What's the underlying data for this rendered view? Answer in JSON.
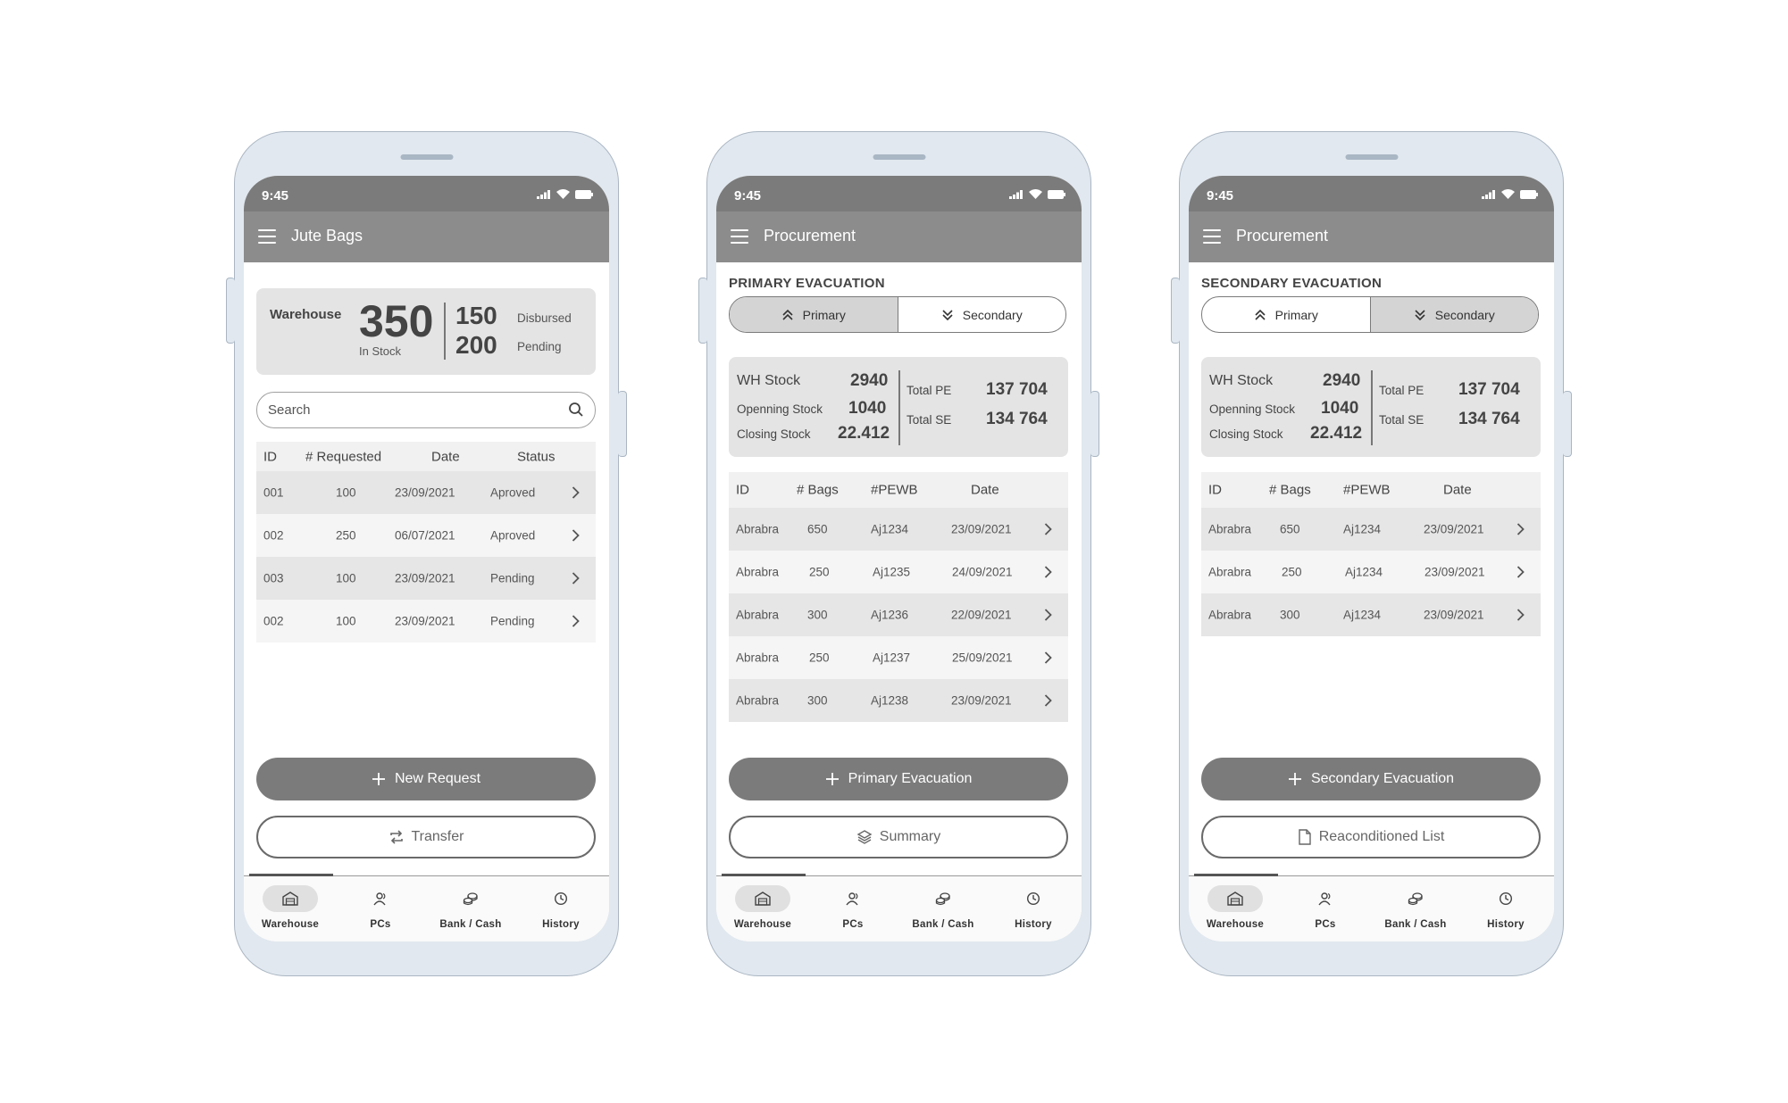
{
  "status_time": "9:45",
  "nav": [
    {
      "label": "Warehouse",
      "icon": "warehouse-icon"
    },
    {
      "label": "PCs",
      "icon": "users-icon"
    },
    {
      "label": "Bank / Cash",
      "icon": "coins-icon"
    },
    {
      "label": "History",
      "icon": "clock-icon"
    }
  ],
  "phone1": {
    "title": "Jute Bags",
    "summary": {
      "label": "Warehouse",
      "in_stock_value": "350",
      "in_stock_label": "In Stock",
      "disbursed_value": "150",
      "disbursed_label": "Disbursed",
      "pending_value": "200",
      "pending_label": "Pending"
    },
    "search_placeholder": "Search",
    "columns": [
      "ID",
      "# Requested",
      "Date",
      "Status"
    ],
    "rows": [
      [
        "001",
        "100",
        "23/09/2021",
        "Aproved"
      ],
      [
        "002",
        "250",
        "06/07/2021",
        "Aproved"
      ],
      [
        "003",
        "100",
        "23/09/2021",
        "Pending"
      ],
      [
        "002",
        "100",
        "23/09/2021",
        "Pending"
      ]
    ],
    "primary_button": "New Request",
    "secondary_button": "Transfer"
  },
  "phone2": {
    "title": "Procurement",
    "section": "PRIMARY EVACUATION",
    "tabs": [
      "Primary",
      "Secondary"
    ],
    "stats": {
      "wh_stock_label": "WH Stock",
      "wh_stock_value": "2940",
      "opening_label": "Openning Stock",
      "opening_value": "1040",
      "closing_label": "Closing Stock",
      "closing_value": "22.412",
      "total_pe_label": "Total PE",
      "total_pe_value": "137 704",
      "total_se_label": "Total SE",
      "total_se_value": "134 764"
    },
    "columns": [
      "ID",
      "# Bags",
      "#PEWB",
      "Date"
    ],
    "rows": [
      [
        "Abrabra",
        "650",
        "Aj1234",
        "23/09/2021"
      ],
      [
        "Abrabra",
        "250",
        "Aj1235",
        "24/09/2021"
      ],
      [
        "Abrabra",
        "300",
        "Aj1236",
        "22/09/2021"
      ],
      [
        "Abrabra",
        "250",
        "Aj1237",
        "25/09/2021"
      ],
      [
        "Abrabra",
        "300",
        "Aj1238",
        "23/09/2021"
      ]
    ],
    "primary_button": "Primary Evacuation",
    "secondary_button": "Summary"
  },
  "phone3": {
    "title": "Procurement",
    "section": "SECONDARY EVACUATION",
    "tabs": [
      "Primary",
      "Secondary"
    ],
    "stats": {
      "wh_stock_label": "WH Stock",
      "wh_stock_value": "2940",
      "opening_label": "Openning Stock",
      "opening_value": "1040",
      "closing_label": "Closing Stock",
      "closing_value": "22.412",
      "total_pe_label": "Total PE",
      "total_pe_value": "137 704",
      "total_se_label": "Total SE",
      "total_se_value": "134 764"
    },
    "columns": [
      "ID",
      "# Bags",
      "#PEWB",
      "Date"
    ],
    "rows": [
      [
        "Abrabra",
        "650",
        "Aj1234",
        "23/09/2021"
      ],
      [
        "Abrabra",
        "250",
        "Aj1234",
        "23/09/2021"
      ],
      [
        "Abrabra",
        "300",
        "Aj1234",
        "23/09/2021"
      ]
    ],
    "primary_button": "Secondary Evacuation",
    "secondary_button": "Reaconditioned List"
  }
}
